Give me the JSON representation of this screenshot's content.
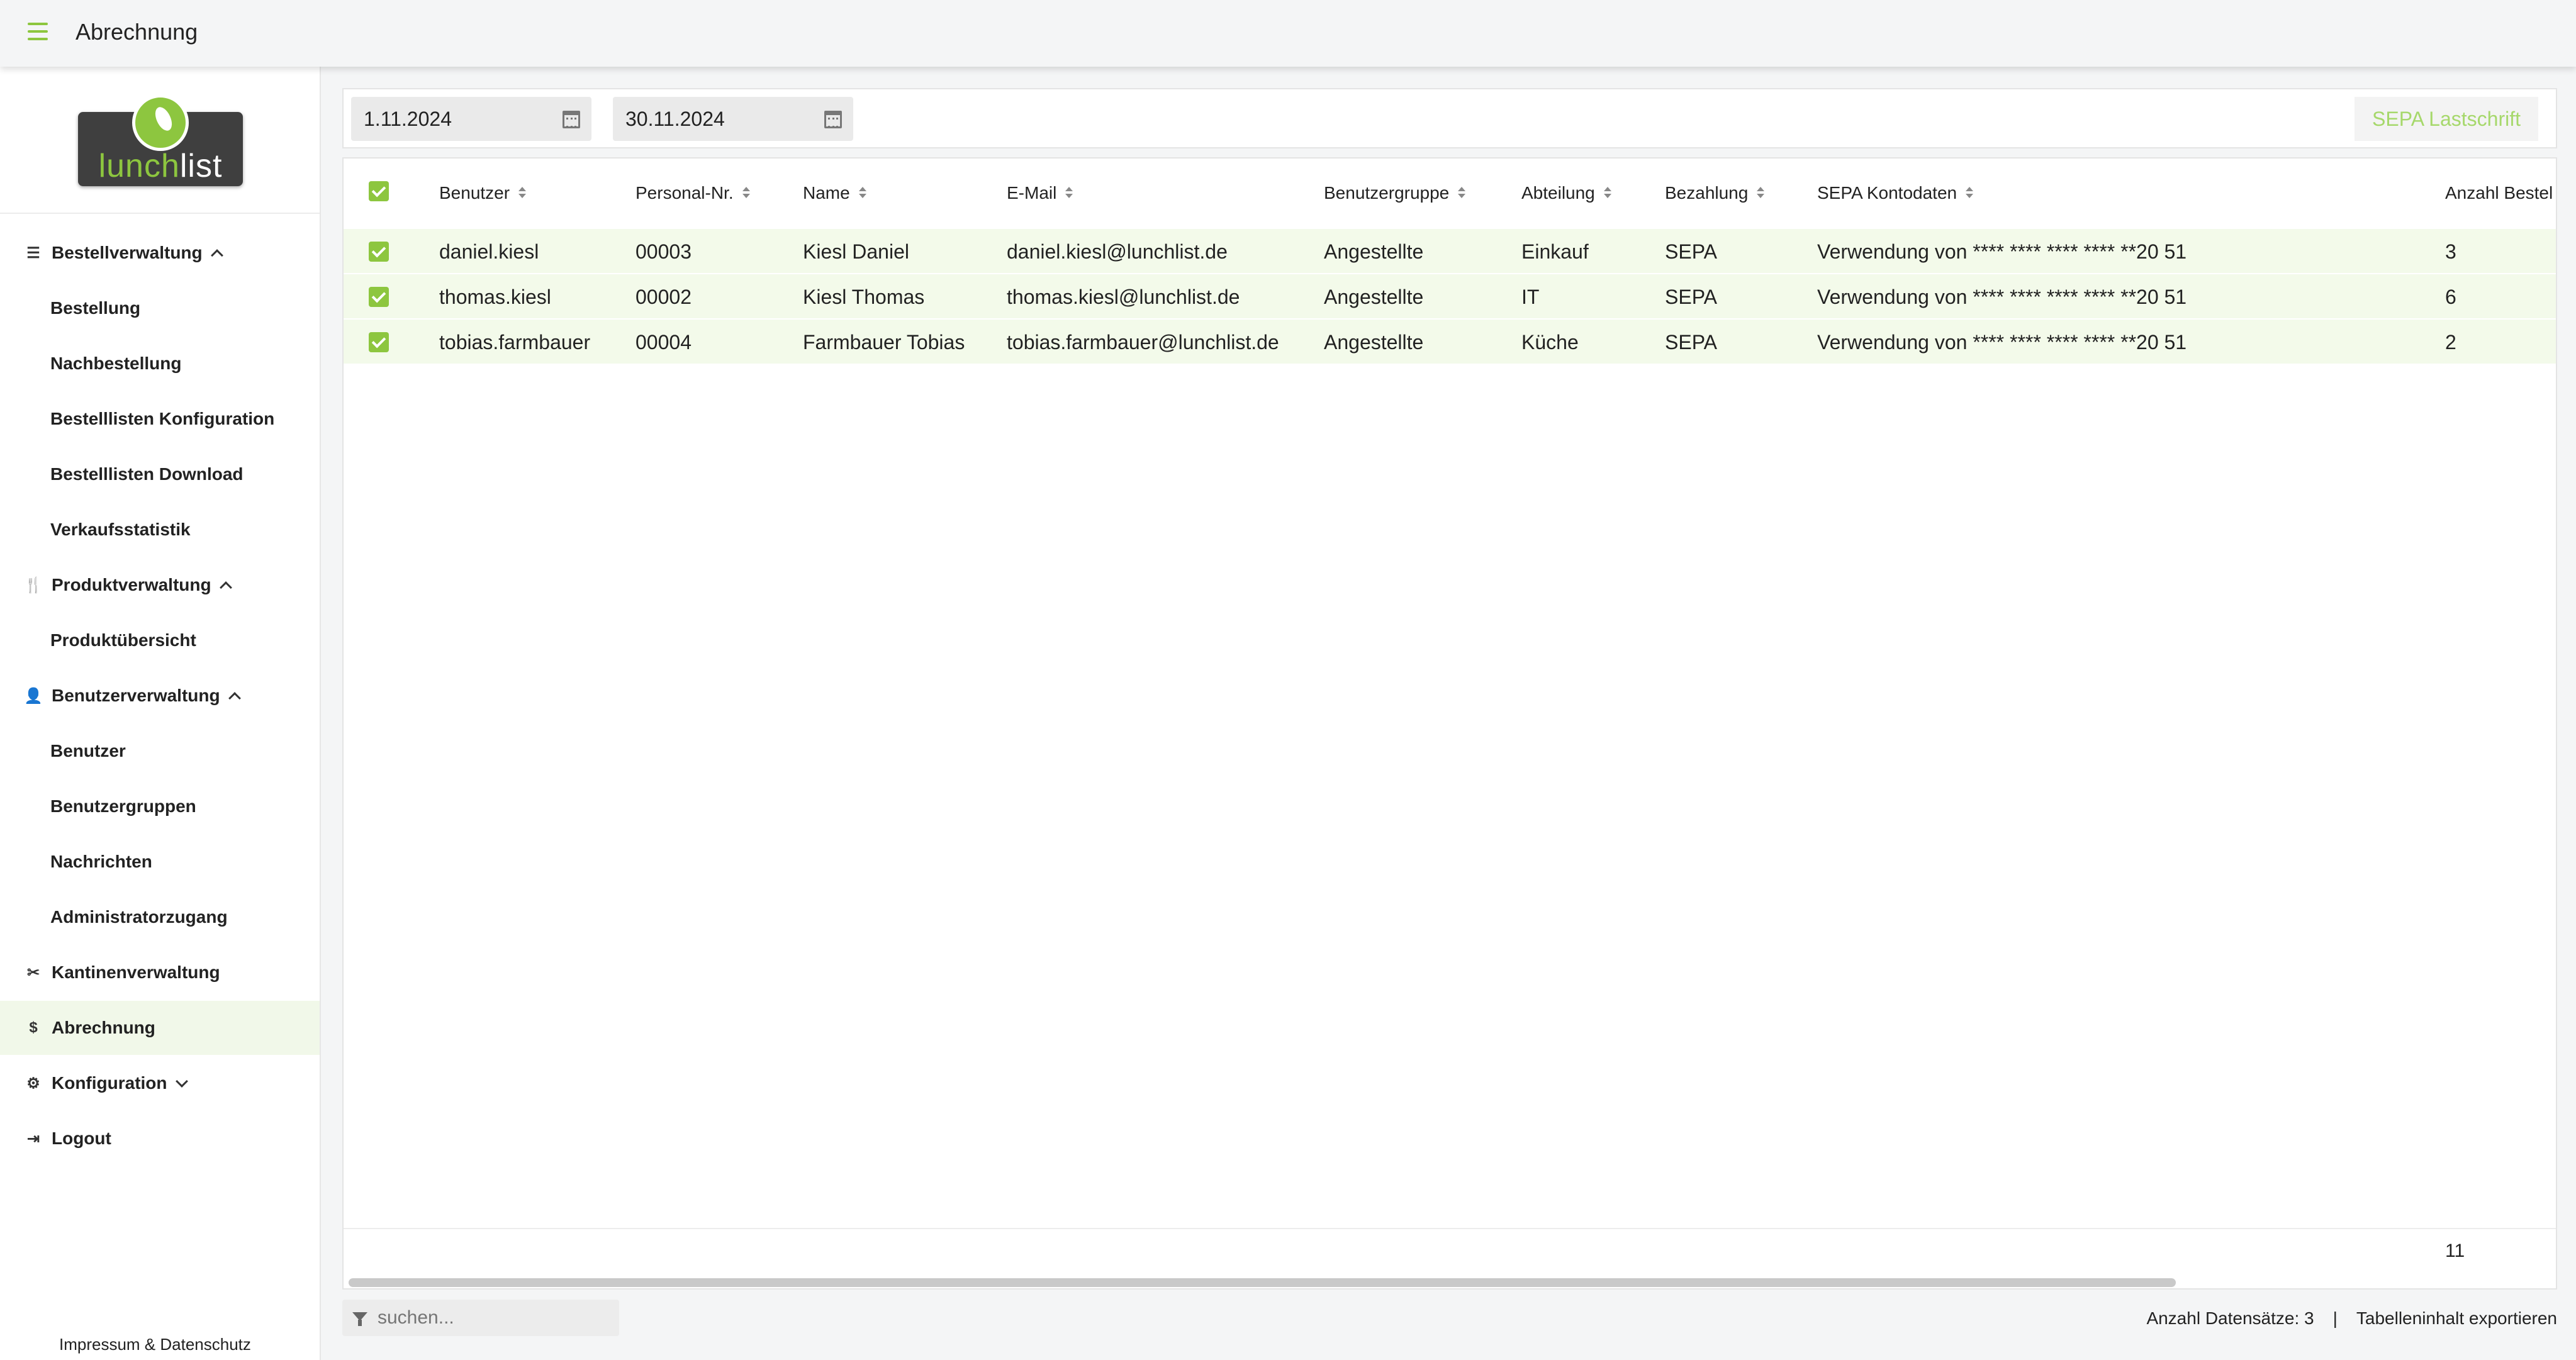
{
  "header": {
    "title": "Abrechnung"
  },
  "brand": {
    "logo_part1": "lunch",
    "logo_part2": "list"
  },
  "sidebar": {
    "items": [
      {
        "label": "Bestellverwaltung",
        "kind": "group",
        "icon": "list-icon",
        "chevron": "up"
      },
      {
        "label": "Bestellung",
        "kind": "sub"
      },
      {
        "label": "Nachbestellung",
        "kind": "sub"
      },
      {
        "label": "Bestelllisten Konfiguration",
        "kind": "sub"
      },
      {
        "label": "Bestelllisten Download",
        "kind": "sub"
      },
      {
        "label": "Verkaufsstatistik",
        "kind": "sub"
      },
      {
        "label": "Produktverwaltung",
        "kind": "group",
        "icon": "cutlery-icon",
        "chevron": "up"
      },
      {
        "label": "Produktübersicht",
        "kind": "sub"
      },
      {
        "label": "Benutzerverwaltung",
        "kind": "group",
        "icon": "user-icon",
        "chevron": "up"
      },
      {
        "label": "Benutzer",
        "kind": "sub"
      },
      {
        "label": "Benutzergruppen",
        "kind": "sub"
      },
      {
        "label": "Nachrichten",
        "kind": "sub"
      },
      {
        "label": "Administratorzugang",
        "kind": "sub"
      },
      {
        "label": "Kantinenverwaltung",
        "kind": "group",
        "icon": "tools-icon"
      },
      {
        "label": "Abrechnung",
        "kind": "group",
        "icon": "dollar-icon",
        "active": true
      },
      {
        "label": "Konfiguration",
        "kind": "group",
        "icon": "gear-icon",
        "chevron": "down"
      },
      {
        "label": "Logout",
        "kind": "group",
        "icon": "logout-icon"
      }
    ],
    "footer": "Impressum & Datenschutz"
  },
  "toolbar": {
    "date_from": "1.11.2024",
    "date_to": "30.11.2024",
    "sepa_button": "SEPA Lastschrift"
  },
  "table": {
    "columns": [
      "Benutzer",
      "Personal-Nr.",
      "Name",
      "E-Mail",
      "Benutzergruppe",
      "Abteilung",
      "Bezahlung",
      "SEPA Kontodaten",
      "Anzahl Bestel"
    ],
    "rows": [
      [
        "daniel.kiesl",
        "00003",
        "Kiesl Daniel",
        "daniel.kiesl@lunchlist.de",
        "Angestellte",
        "Einkauf",
        "SEPA",
        "Verwendung von **** **** **** **** **20 51",
        "3"
      ],
      [
        "thomas.kiesl",
        "00002",
        "Kiesl Thomas",
        "thomas.kiesl@lunchlist.de",
        "Angestellte",
        "IT",
        "SEPA",
        "Verwendung von **** **** **** **** **20 51",
        "6"
      ],
      [
        "tobias.farmbauer",
        "00004",
        "Farmbauer Tobias",
        "tobias.farmbauer@lunchlist.de",
        "Angestellte",
        "Küche",
        "SEPA",
        "Verwendung von **** **** **** **** **20 51",
        "2"
      ]
    ],
    "footer_total": "11"
  },
  "search": {
    "placeholder": "suchen..."
  },
  "status": {
    "count_text": "Anzahl Datensätze: 3",
    "separator": "|",
    "export_link": "Tabelleninhalt exportieren"
  },
  "colors": {
    "accent": "#8dc63f",
    "row_bg": "#f3faea",
    "button_text": "#a6d86b"
  }
}
